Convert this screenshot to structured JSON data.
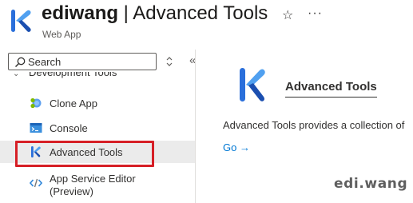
{
  "header": {
    "app_name": "ediwang",
    "page_title": " | Advanced Tools",
    "subtitle": "Web App",
    "favorite_icon": "star-icon",
    "more_icon": "more-icon",
    "more_glyph": "···"
  },
  "sidebar": {
    "search_placeholder": "Search",
    "collapse_glyph": "«",
    "group_label": "Development Tools",
    "items": [
      {
        "label": "Clone App",
        "icon": "clone-app-icon"
      },
      {
        "label": "Console",
        "icon": "console-icon"
      },
      {
        "label": "Advanced Tools",
        "icon": "advanced-tools-icon",
        "selected": true
      },
      {
        "label": "App Service Editor",
        "label_line2": "(Preview)",
        "icon": "code-editor-icon"
      }
    ]
  },
  "content": {
    "title": "Advanced Tools",
    "description": "Advanced Tools provides a collection of",
    "go_link": "Go →"
  },
  "watermark": "edi.wang",
  "colors": {
    "accent": "#0078d4",
    "highlight": "#d61f26",
    "selected_bg": "#ebebeb"
  }
}
